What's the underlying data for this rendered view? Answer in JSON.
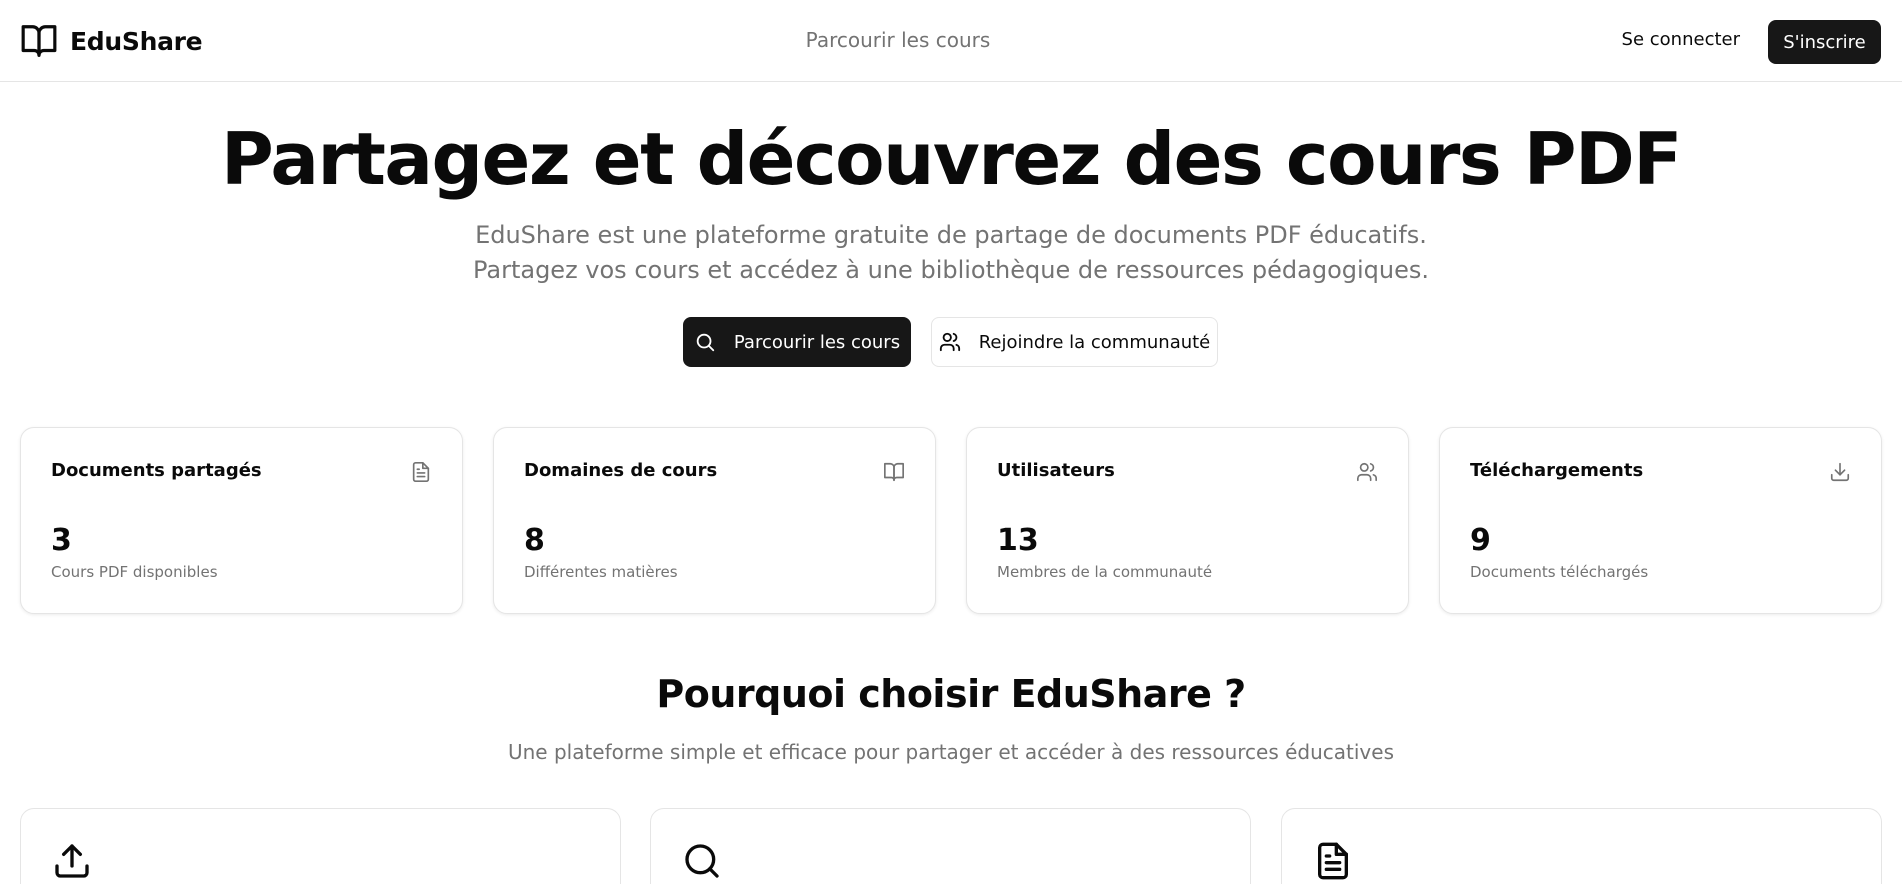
{
  "app": {
    "brand_name": "EduShare",
    "logo_icon": "book-open-icon"
  },
  "nav": {
    "browse_link": "Parcourir les cours",
    "login_label": "Se connecter",
    "signup_label": "S'inscrire"
  },
  "hero": {
    "title": "Partagez et découvrez des cours PDF",
    "subtitle_line1": "EduShare est une plateforme gratuite de partage de documents PDF éducatifs.",
    "subtitle_line2": "Partagez vos cours et accédez à une bibliothèque de ressources pédagogiques.",
    "primary_button": {
      "label": "Parcourir les cours",
      "icon": "search-icon"
    },
    "secondary_button": {
      "label": "Rejoindre la communauté",
      "icon": "users-icon"
    }
  },
  "stats": [
    {
      "title": "Documents partagés",
      "value": "3",
      "description": "Cours PDF disponibles",
      "icon": "file-text-icon"
    },
    {
      "title": "Domaines de cours",
      "value": "8",
      "description": "Différentes matières",
      "icon": "book-open-icon"
    },
    {
      "title": "Utilisateurs",
      "value": "13",
      "description": "Membres de la communauté",
      "icon": "users-icon"
    },
    {
      "title": "Téléchargements",
      "value": "9",
      "description": "Documents téléchargés",
      "icon": "download-icon"
    }
  ],
  "why": {
    "title": "Pourquoi choisir EduShare ?",
    "subtitle": "Une plateforme simple et efficace pour partager et accéder à des ressources éducatives",
    "features": [
      {
        "icon": "upload-icon"
      },
      {
        "icon": "search-icon"
      },
      {
        "icon": "file-text-icon"
      }
    ]
  },
  "colors": {
    "primary": "#171717",
    "muted_text": "#737373",
    "border": "#e5e5e5",
    "background": "#ffffff"
  }
}
